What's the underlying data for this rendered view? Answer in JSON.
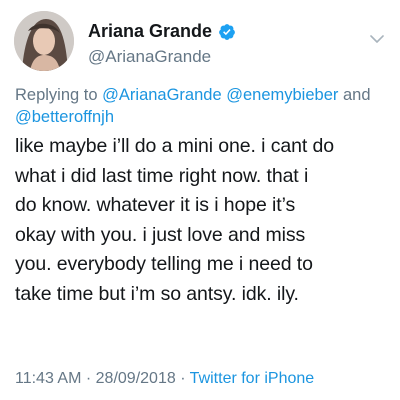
{
  "author": {
    "display_name": "Ariana Grande",
    "handle": "@ArianaGrande",
    "avatar_icon": "profile-photo",
    "verified_icon": "verified-badge-icon"
  },
  "reply": {
    "prefix": "Replying to",
    "mentions": [
      "@ArianaGrande",
      "@enemybieber",
      "@betteroffnjh"
    ],
    "conjunction": "and"
  },
  "tweet": {
    "lines": [
      "like maybe i’ll do a mini one. i cant do",
      "what i did last time right now. that i",
      "do know. whatever it is i hope it’s",
      "okay with you. i just love and miss",
      "you. everybody telling me i need to",
      "take time but i’m so antsy. idk. ily."
    ]
  },
  "meta": {
    "time": "11:43 AM",
    "separator": "·",
    "date": "28/09/2018",
    "source": "Twitter for iPhone"
  },
  "colors": {
    "text": "#14171a",
    "secondary": "#657786",
    "link": "#1b95e0",
    "verified": "#1da1f2"
  }
}
